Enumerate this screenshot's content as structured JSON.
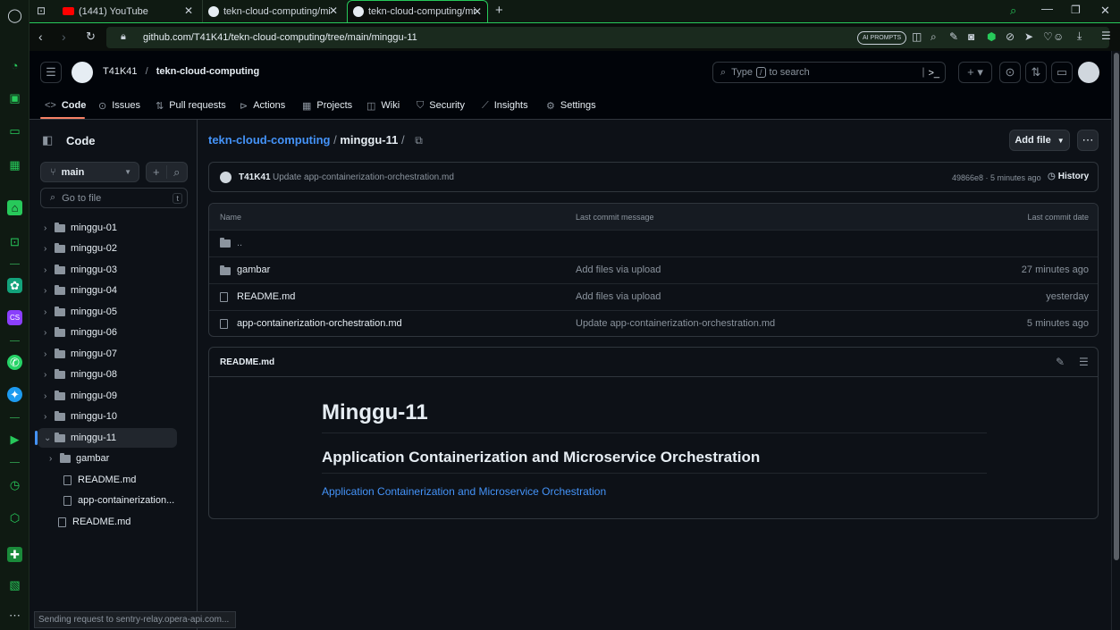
{
  "browser": {
    "tabs": [
      {
        "label": "(1441) YouTube"
      },
      {
        "label": "tekn-cloud-computing/mi"
      },
      {
        "label": "tekn-cloud-computing/mi"
      }
    ],
    "new_tab": "+",
    "url": "github.com/T41K41/tekn-cloud-computing/tree/main/minggu-11",
    "ai_prompts": "AI PROMPTS",
    "status_text": "Sending request to sentry-relay.opera-api.com..."
  },
  "github": {
    "owner": "T41K41",
    "separator": "/",
    "repo": "tekn-cloud-computing",
    "search_placeholder": "Type / to search",
    "search_prefix": "Type",
    "search_key": "/",
    "search_suffix": "to search",
    "nav_tabs": [
      {
        "label": "Code",
        "icon": "code-icon"
      },
      {
        "label": "Issues",
        "icon": "issue-icon"
      },
      {
        "label": "Pull requests",
        "icon": "pull-request-icon"
      },
      {
        "label": "Actions",
        "icon": "play-icon"
      },
      {
        "label": "Projects",
        "icon": "table-icon"
      },
      {
        "label": "Wiki",
        "icon": "book-icon"
      },
      {
        "label": "Security",
        "icon": "shield-icon"
      },
      {
        "label": "Insights",
        "icon": "graph-icon"
      },
      {
        "label": "Settings",
        "icon": "gear-icon"
      }
    ]
  },
  "tree": {
    "title": "Code",
    "branch": "main",
    "filter_placeholder": "Go to file",
    "filter_key": "t",
    "items": [
      {
        "label": "minggu-01",
        "type": "folder"
      },
      {
        "label": "minggu-02",
        "type": "folder"
      },
      {
        "label": "minggu-03",
        "type": "folder"
      },
      {
        "label": "minggu-04",
        "type": "folder"
      },
      {
        "label": "minggu-05",
        "type": "folder"
      },
      {
        "label": "minggu-06",
        "type": "folder"
      },
      {
        "label": "minggu-07",
        "type": "folder"
      },
      {
        "label": "minggu-08",
        "type": "folder"
      },
      {
        "label": "minggu-09",
        "type": "folder"
      },
      {
        "label": "minggu-10",
        "type": "folder"
      },
      {
        "label": "minggu-11",
        "type": "folder-open",
        "selected": true
      },
      {
        "label": "gambar",
        "type": "folder",
        "indent": true
      },
      {
        "label": "README.md",
        "type": "file",
        "indent": true
      },
      {
        "label": "app-containerization...",
        "type": "file",
        "indent": true
      },
      {
        "label": "README.md",
        "type": "file"
      }
    ]
  },
  "main": {
    "breadcrumb_repo": "tekn-cloud-computing",
    "breadcrumb_sep": "/",
    "breadcrumb_dir": "minggu-11",
    "breadcrumb_trail": "/",
    "add_file": "Add file",
    "commit": {
      "author": "T41K41",
      "message": "Update app-containerization-orchestration.md",
      "hash_time": "49866e8 · 5 minutes ago",
      "history": "History"
    },
    "table": {
      "headers": [
        "Name",
        "Last commit message",
        "Last commit date"
      ],
      "parent": "..",
      "rows": [
        {
          "name": "gambar",
          "type": "folder",
          "message": "Add files via upload",
          "date": "27 minutes ago"
        },
        {
          "name": "README.md",
          "type": "file",
          "message": "Add files via upload",
          "date": "yesterday"
        },
        {
          "name": "app-containerization-orchestration.md",
          "type": "file",
          "message": "Update app-containerization-orchestration.md",
          "date": "5 minutes ago"
        }
      ]
    },
    "readme": {
      "label": "README.md",
      "h1": "Minggu-11",
      "h2": "Application Containerization and Microservice Orchestration",
      "link": "Application Containerization and Microservice Orchestration"
    }
  },
  "colors": {
    "accent_green": "#27c95a",
    "link_blue": "#4493f8",
    "tab_underline": "#f78166"
  }
}
